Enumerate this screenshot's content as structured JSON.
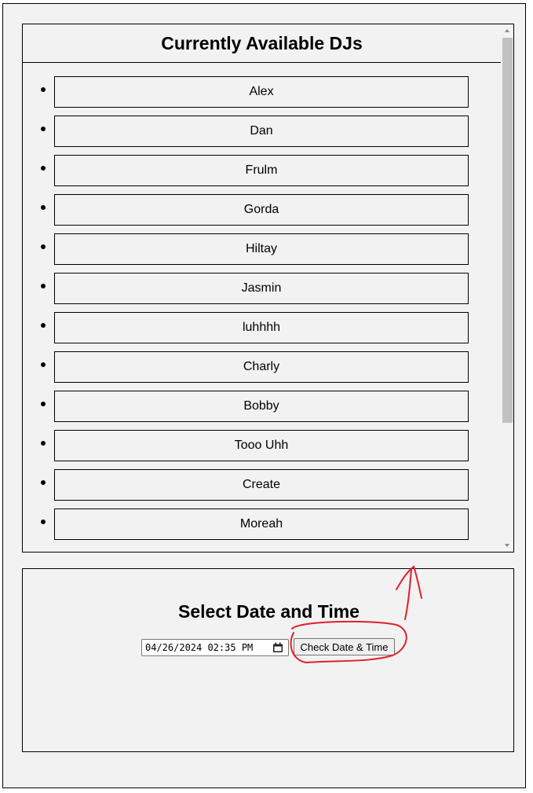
{
  "dj_panel": {
    "title": "Currently Available DJs",
    "djs": [
      "Alex",
      "Dan",
      "Frulm",
      "Gorda",
      "Hiltay",
      "Jasmin",
      "luhhhh",
      "Charly",
      "Bobby",
      "Tooo Uhh",
      "Create",
      "Moreah"
    ]
  },
  "date_panel": {
    "title": "Select Date and Time",
    "datetime_value": "04/26/2024 02:35 PM",
    "check_button_label": "Check Date & Time"
  },
  "icons": {
    "calendar": "calendar-icon",
    "scroll_up": "scroll-up-arrow-icon",
    "scroll_down": "scroll-down-arrow-icon"
  },
  "colors": {
    "background": "#f2f2f2",
    "annotation": "#e0202a"
  }
}
